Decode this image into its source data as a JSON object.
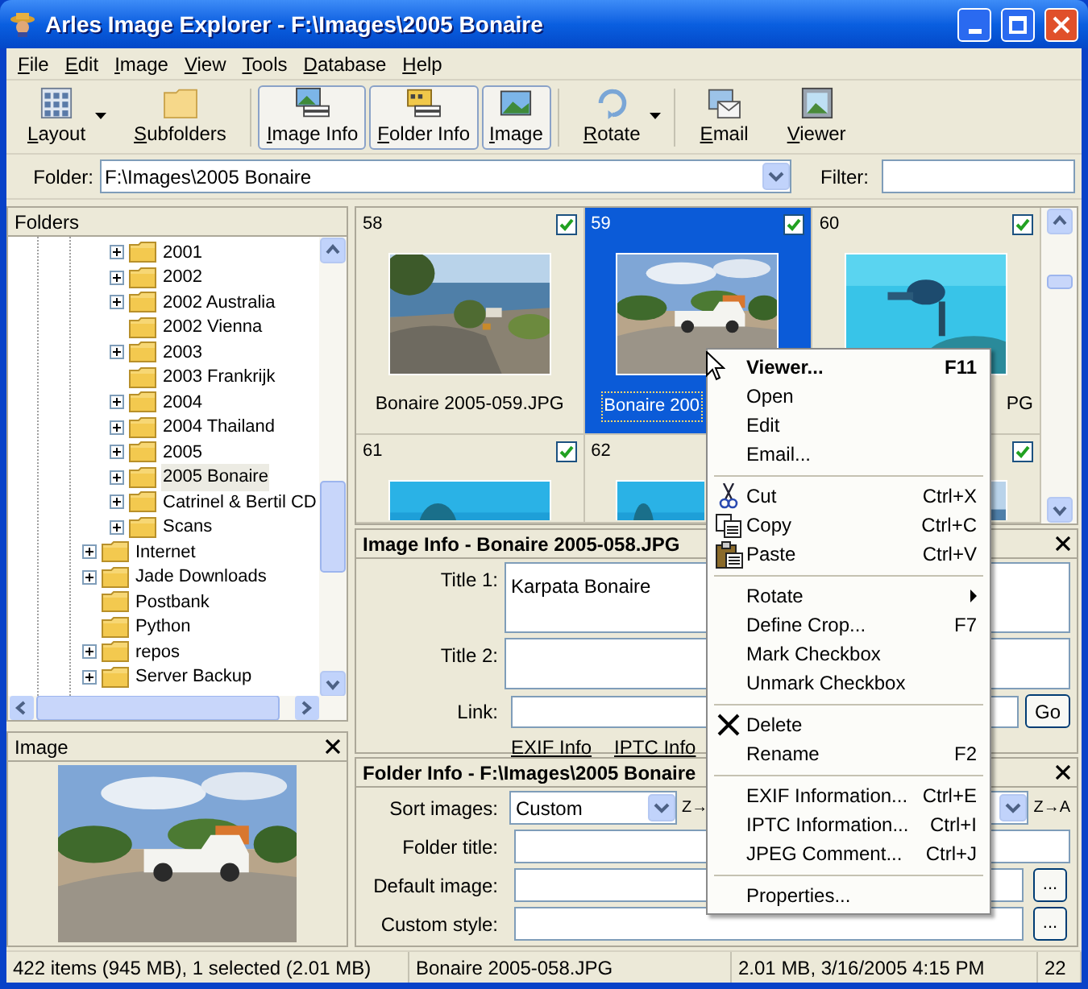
{
  "window": {
    "title": "Arles Image Explorer - F:\\Images\\2005 Bonaire"
  },
  "menu": [
    "File",
    "Edit",
    "Image",
    "View",
    "Tools",
    "Database",
    "Help"
  ],
  "toolbar": [
    {
      "kind": "layout",
      "label": "Layout",
      "dropdown": true,
      "pressed": false
    },
    {
      "kind": "subfolders",
      "label": "Subfolders",
      "dropdown": false,
      "pressed": false
    },
    {
      "kind": "image-info",
      "label": "Image Info",
      "dropdown": false,
      "pressed": true
    },
    {
      "kind": "folder-info",
      "label": "Folder Info",
      "dropdown": false,
      "pressed": true
    },
    {
      "label": "Image",
      "dropdown": false,
      "pressed": true
    },
    {
      "kind": "rotate",
      "label": "Rotate",
      "dropdown": true,
      "pressed": false
    },
    {
      "kind": "email",
      "label": "Email",
      "dropdown": false,
      "pressed": false
    },
    {
      "kind": "viewer",
      "label": "Viewer",
      "dropdown": false,
      "pressed": false
    }
  ],
  "folder_bar": {
    "label": "Folder:",
    "value": "F:\\Images\\2005 Bonaire",
    "filter_label": "Filter:"
  },
  "folders_panel": {
    "title": "Folders",
    "tree": [
      {
        "children": [
          {
            "label": "2001",
            "expandable": true,
            "selected": false
          },
          {
            "label": "2002",
            "expandable": true,
            "selected": false
          },
          {
            "label": "2002 Australia",
            "expandable": true,
            "selected": false
          },
          {
            "label": "2002 Vienna",
            "expandable": false,
            "selected": false
          },
          {
            "label": "2003",
            "expandable": true,
            "selected": false
          },
          {
            "label": "2003 Frankrijk",
            "expandable": false,
            "selected": false
          },
          {
            "label": "2004",
            "expandable": true,
            "selected": false
          },
          {
            "label": "2004 Thailand",
            "expandable": true,
            "selected": false
          },
          {
            "label": "2005",
            "expandable": true,
            "selected": false
          },
          {
            "label": "2005 Bonaire",
            "expandable": true,
            "selected": true
          },
          {
            "label": "Catrinel & Bertil CD",
            "expandable": true,
            "selected": false
          },
          {
            "label": "Scans",
            "expandable": true,
            "selected": false
          }
        ]
      },
      {
        "label": "Internet",
        "expandable": true,
        "selected": false
      },
      {
        "label": "Jade Downloads",
        "expandable": true,
        "selected": false
      },
      {
        "label": "Postbank",
        "expandable": false,
        "selected": false
      },
      {
        "label": "Python",
        "expandable": false,
        "selected": false
      },
      {
        "label": "repos",
        "expandable": true,
        "selected": false
      },
      {
        "label": "Server Backup",
        "expandable": true,
        "selected": false
      }
    ]
  },
  "image_panel": {
    "title": "Image"
  },
  "thumbnails": [
    {
      "number": "58",
      "checked": true,
      "selected": false,
      "caption": "Bonaire 2005-059.JPG"
    },
    {
      "number": "59",
      "checked": true,
      "selected": true,
      "caption": "Bonaire 200"
    },
    {
      "number": "60",
      "checked": true,
      "selected": false,
      "caption": "PG"
    },
    {
      "number": "61",
      "checked": true,
      "selected": false
    },
    {
      "number": "62",
      "selected": false
    },
    {
      "checked": true,
      "selected": false
    }
  ],
  "image_info": {
    "title": "Image Info - Bonaire 2005-058.JPG",
    "fields": [
      {
        "kind": "textarea",
        "label": "Title 1:",
        "value": "Karpata Bonaire"
      },
      {
        "kind": "textarea",
        "label": "Title 2:"
      },
      {
        "kind": "link",
        "label": "Link:",
        "button": "Go"
      }
    ],
    "links": [
      "EXIF Info",
      "IPTC Info"
    ]
  },
  "folder_info": {
    "title": "Folder Info - F:\\Images\\2005 Bonaire",
    "sort": {
      "label": "Sort images:",
      "value": "Custom",
      "order_left": "Z→",
      "order_right": "Z→A"
    },
    "fields": [
      {
        "kind": "text",
        "label": "Folder title:"
      },
      {
        "kind": "browse",
        "label": "Default image:",
        "button": "..."
      },
      {
        "kind": "browse",
        "label": "Custom style:",
        "button": "..."
      }
    ]
  },
  "context_menu": [
    {
      "kind": "item",
      "label": "Viewer...",
      "shortcut": "F11",
      "default": true,
      "submenu": false
    },
    {
      "kind": "item",
      "label": "Open",
      "default": false,
      "submenu": false
    },
    {
      "kind": "item",
      "label": "Edit",
      "default": false,
      "submenu": false
    },
    {
      "kind": "item",
      "label": "Email...",
      "default": false,
      "submenu": false
    },
    {
      "kind": "separator"
    },
    {
      "kind": "item",
      "label": "Cut",
      "shortcut": "Ctrl+X",
      "default": false,
      "submenu": false
    },
    {
      "kind": "item",
      "label": "Copy",
      "shortcut": "Ctrl+C",
      "default": false,
      "submenu": false
    },
    {
      "kind": "item",
      "label": "Paste",
      "shortcut": "Ctrl+V",
      "default": false,
      "submenu": false
    },
    {
      "kind": "separator"
    },
    {
      "kind": "item",
      "label": "Rotate",
      "default": false,
      "submenu": true
    },
    {
      "kind": "item",
      "label": "Define Crop...",
      "shortcut": "F7",
      "default": false,
      "submenu": false
    },
    {
      "kind": "item",
      "label": "Mark Checkbox",
      "default": false,
      "submenu": false
    },
    {
      "kind": "item",
      "label": "Unmark Checkbox",
      "default": false,
      "submenu": false
    },
    {
      "kind": "separator"
    },
    {
      "kind": "item",
      "label": "Delete",
      "default": false,
      "submenu": false
    },
    {
      "kind": "item",
      "label": "Rename",
      "shortcut": "F2",
      "default": false,
      "submenu": false
    },
    {
      "kind": "separator"
    },
    {
      "kind": "item",
      "label": "EXIF Information...",
      "shortcut": "Ctrl+E",
      "default": false,
      "submenu": false
    },
    {
      "kind": "item",
      "label": "IPTC Information...",
      "shortcut": "Ctrl+I",
      "default": false,
      "submenu": false
    },
    {
      "kind": "item",
      "label": "JPEG Comment...",
      "shortcut": "Ctrl+J",
      "default": false,
      "submenu": false
    },
    {
      "kind": "separator"
    },
    {
      "kind": "item",
      "label": "Properties...",
      "default": false,
      "submenu": false
    }
  ],
  "status_bar": [
    "422 items (945 MB), 1 selected (2.01 MB)",
    "Bonaire 2005-058.JPG",
    "2.01 MB, 3/16/2005 4:15 PM",
    "22"
  ]
}
